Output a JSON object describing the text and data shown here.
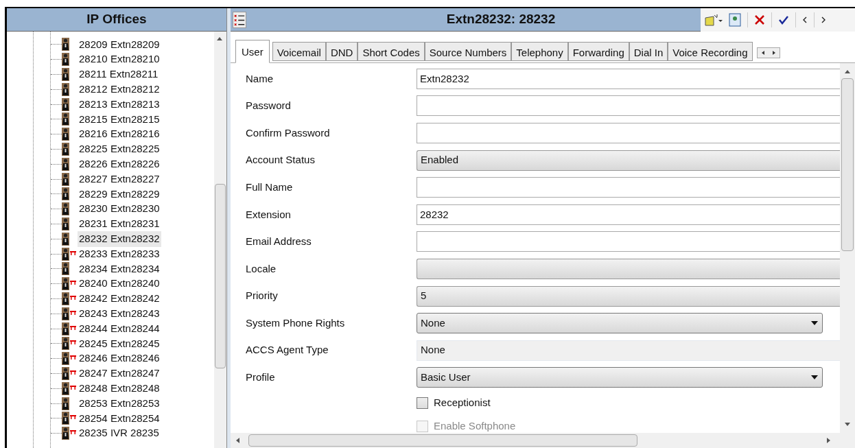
{
  "tree": {
    "title": "IP Offices",
    "items": [
      {
        "label": "28209 Extn28209",
        "forwarding": false,
        "selected": false
      },
      {
        "label": "28210 Extn28210",
        "forwarding": false,
        "selected": false
      },
      {
        "label": "28211 Extn28211",
        "forwarding": false,
        "selected": false
      },
      {
        "label": "28212 Extn28212",
        "forwarding": false,
        "selected": false
      },
      {
        "label": "28213 Extn28213",
        "forwarding": false,
        "selected": false
      },
      {
        "label": "28215 Extn28215",
        "forwarding": false,
        "selected": false
      },
      {
        "label": "28216 Extn28216",
        "forwarding": false,
        "selected": false
      },
      {
        "label": "28225 Extn28225",
        "forwarding": false,
        "selected": false
      },
      {
        "label": "28226 Extn28226",
        "forwarding": false,
        "selected": false
      },
      {
        "label": "28227 Extn28227",
        "forwarding": false,
        "selected": false
      },
      {
        "label": "28229 Extn28229",
        "forwarding": false,
        "selected": false
      },
      {
        "label": "28230 Extn28230",
        "forwarding": false,
        "selected": false
      },
      {
        "label": "28231 Extn28231",
        "forwarding": false,
        "selected": false
      },
      {
        "label": "28232 Extn28232",
        "forwarding": false,
        "selected": true
      },
      {
        "label": "28233 Extn28233",
        "forwarding": true,
        "selected": false
      },
      {
        "label": "28234 Extn28234",
        "forwarding": false,
        "selected": false
      },
      {
        "label": "28240 Extn28240",
        "forwarding": true,
        "selected": false
      },
      {
        "label": "28242 Extn28242",
        "forwarding": true,
        "selected": false
      },
      {
        "label": "28243 Extn28243",
        "forwarding": true,
        "selected": false
      },
      {
        "label": "28244 Extn28244",
        "forwarding": true,
        "selected": false
      },
      {
        "label": "28245 Extn28245",
        "forwarding": true,
        "selected": false
      },
      {
        "label": "28246 Extn28246",
        "forwarding": true,
        "selected": false
      },
      {
        "label": "28247 Extn28247",
        "forwarding": true,
        "selected": false
      },
      {
        "label": "28248 Extn28248",
        "forwarding": true,
        "selected": false
      },
      {
        "label": "28253 Extn28253",
        "forwarding": false,
        "selected": false
      },
      {
        "label": "28254 Extn28254",
        "forwarding": true,
        "selected": false
      },
      {
        "label": "28235 IVR 28235",
        "forwarding": true,
        "selected": false
      }
    ]
  },
  "editor": {
    "title": "Extn28232: 28232",
    "tabs": [
      {
        "label": "User",
        "selected": true
      },
      {
        "label": "Voicemail",
        "selected": false
      },
      {
        "label": "DND",
        "selected": false
      },
      {
        "label": "Short Codes",
        "selected": false
      },
      {
        "label": "Source Numbers",
        "selected": false
      },
      {
        "label": "Telephony",
        "selected": false
      },
      {
        "label": "Forwarding",
        "selected": false
      },
      {
        "label": "Dial In",
        "selected": false
      },
      {
        "label": "Voice Recording",
        "selected": false
      }
    ],
    "fields": [
      {
        "kind": "text",
        "label": "Name",
        "value": "Extn28232"
      },
      {
        "kind": "text",
        "label": "Password"
      },
      {
        "kind": "text",
        "label": "Confirm Password"
      },
      {
        "kind": "combo",
        "label": "Account Status",
        "value": "Enabled"
      },
      {
        "kind": "text",
        "label": "Full Name"
      },
      {
        "kind": "text",
        "label": "Extension",
        "value": "28232"
      },
      {
        "kind": "text",
        "label": "Email Address"
      },
      {
        "kind": "combo",
        "label": "Locale"
      },
      {
        "kind": "combo",
        "label": "Priority",
        "value": "5"
      },
      {
        "kind": "dropdown",
        "label": "System Phone Rights",
        "value": "None"
      },
      {
        "kind": "readonly",
        "label": "ACCS Agent Type",
        "value": "None"
      },
      {
        "kind": "dropdown",
        "label": "Profile",
        "value": "Basic User"
      }
    ],
    "checkboxes": [
      {
        "label": "Receptionist",
        "checked": false,
        "disabled": false
      },
      {
        "label": "Enable Softphone",
        "checked": false,
        "disabled": true
      }
    ]
  }
}
